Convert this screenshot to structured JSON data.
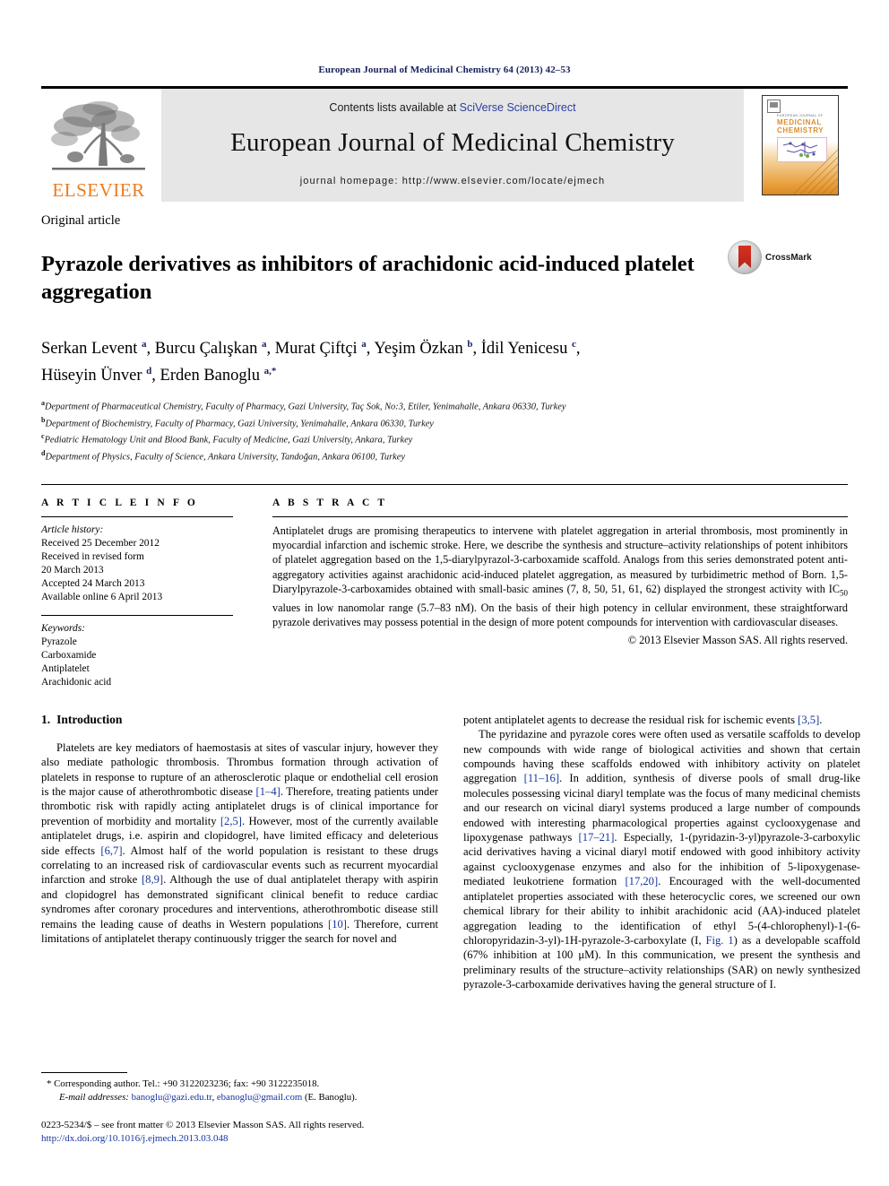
{
  "running_head": "European Journal of Medicinal Chemistry 64 (2013) 42–53",
  "masthead": {
    "publisher_name": "ELSEVIER",
    "contents_prefix": "Contents lists available at ",
    "contents_link": "SciVerse ScienceDirect",
    "journal_title": "European Journal of Medicinal Chemistry",
    "homepage": "journal homepage: http://www.elsevier.com/locate/ejmech",
    "cover": {
      "publisher_line": "EUROPEAN JOURNAL OF",
      "title_line1": "MEDICINAL",
      "title_line2": "CHEMISTRY"
    }
  },
  "article": {
    "type": "Original article",
    "title": "Pyrazole derivatives as inhibitors of arachidonic acid-induced platelet aggregation",
    "crossmark_label": "CrossMark",
    "authors_line1": "Serkan Levent a, Burcu Çalışkan a, Murat Çiftçi a, Yeşim Özkan b, İdil Yenicesu c,",
    "authors_line2": "Hüseyin Ünver d, Erden Banoglu a,*",
    "affiliations": [
      {
        "mark": "a",
        "text": "Department of Pharmaceutical Chemistry, Faculty of Pharmacy, Gazi University, Taç Sok, No:3, Etiler, Yenimahalle, Ankara 06330, Turkey"
      },
      {
        "mark": "b",
        "text": "Department of Biochemistry, Faculty of Pharmacy, Gazi University, Yenimahalle, Ankara 06330, Turkey"
      },
      {
        "mark": "c",
        "text": "Pediatric Hematology Unit and Blood Bank, Faculty of Medicine, Gazi University, Ankara, Turkey"
      },
      {
        "mark": "d",
        "text": "Department of Physics, Faculty of Science, Ankara University, Tandoğan, Ankara 06100, Turkey"
      }
    ]
  },
  "article_info": {
    "heading": "A R T I C L E   I N F O",
    "history_label": "Article history:",
    "history": [
      "Received 25 December 2012",
      "Received in revised form",
      "20 March 2013",
      "Accepted 24 March 2013",
      "Available online 6 April 2013"
    ],
    "keywords_label": "Keywords:",
    "keywords": [
      "Pyrazole",
      "Carboxamide",
      "Antiplatelet",
      "Arachidonic acid"
    ]
  },
  "abstract": {
    "heading": "A B S T R A C T",
    "text_part1": "Antiplatelet drugs are promising therapeutics to intervene with platelet aggregation in arterial thrombosis, most prominently in myocardial infarction and ischemic stroke. Here, we describe the synthesis and structure–activity relationships of potent inhibitors of platelet aggregation based on the 1,5-diarylpyrazol-3-carboxamide scaffold. Analogs from this series demonstrated potent anti-aggregatory activities against arachidonic acid-induced platelet aggregation, as measured by turbidimetric method of Born. 1,5-Diarylpyrazole-3-carboxamides obtained with small-basic amines (7, 8, 50, 51, 61, 62) displayed the strongest activity with IC",
    "sub": "50",
    "text_part2": " values in low nanomolar range (5.7–83 nM). On the basis of their high potency in cellular environment, these straightforward pyrazole derivatives may possess potential in the design of more potent compounds for intervention with cardiovascular diseases.",
    "copyright": "© 2013 Elsevier Masson SAS. All rights reserved."
  },
  "introduction": {
    "number": "1.",
    "heading": "Introduction",
    "left_p1_a": "Platelets are key mediators of haemostasis at sites of vascular injury, however they also mediate pathologic thrombosis. Thrombus formation through activation of platelets in response to rupture of an atherosclerotic plaque or endothelial cell erosion is the major cause of atherothrombotic disease ",
    "ref_1_4": "[1–4]",
    "left_p1_b": ". Therefore, treating patients under thrombotic risk with rapidly acting antiplatelet drugs is of clinical importance for prevention of morbidity and mortality ",
    "ref_2_5": "[2,5]",
    "left_p1_c": ". However, most of the currently available antiplatelet drugs, i.e. aspirin and clopidogrel, have limited efficacy and deleterious side effects ",
    "ref_6_7": "[6,7]",
    "left_p1_d": ". Almost half of the world population is resistant to these drugs correlating to an increased risk of cardiovascular events such as recurrent myocardial infarction and stroke ",
    "ref_8_9": "[8,9]",
    "left_p1_e": ". Although the use of dual antiplatelet therapy with aspirin and clopidogrel has demonstrated significant clinical benefit to reduce cardiac syndromes after coronary procedures and interventions, atherothrombotic disease still remains the leading cause of deaths in Western populations ",
    "ref_10": "[10]",
    "left_p1_f": ". Therefore, current limitations of antiplatelet therapy continuously trigger the search for novel and ",
    "right_p1_a": "potent antiplatelet agents to decrease the residual risk for ischemic events ",
    "ref_3_5": "[3,5]",
    "right_p1_b": ".",
    "right_p2_a": "The pyridazine and pyrazole cores were often used as versatile scaffolds to develop new compounds with wide range of biological activities and shown that certain compounds having these scaffolds endowed with inhibitory activity on platelet aggregation ",
    "ref_11_16": "[11–16]",
    "right_p2_b": ". In addition, synthesis of diverse pools of small drug-like molecules possessing vicinal diaryl template was the focus of many medicinal chemists and our research on vicinal diaryl systems produced a large number of compounds endowed with interesting pharmacological properties against cyclooxygenase and lipoxygenase pathways ",
    "ref_17_21": "[17–21]",
    "right_p2_c": ". Especially, 1-(pyridazin-3-yl)pyrazole-3-carboxylic acid derivatives having a vicinal diaryl motif endowed with good inhibitory activity against cyclooxygenase enzymes and also for the inhibition of 5-lipoxygenase-mediated leukotriene formation ",
    "ref_17_20": "[17,20]",
    "right_p2_d": ". Encouraged with the well-documented antiplatelet properties associated with these heterocyclic cores, we screened our own chemical library for their ability to inhibit arachidonic acid (AA)-induced platelet aggregation leading to the identification of ethyl 5-(4-chlorophenyl)-1-(6-chloropyridazin-3-yl)-1H-pyrazole-3-carboxylate (I, ",
    "ref_fig1": "Fig. 1",
    "right_p2_e": ") as a developable scaffold (67% inhibition at 100 μM). In this communication, we present the synthesis and preliminary results of the structure–activity relationships (SAR) on newly synthesized pyrazole-3-carboxamide derivatives having the general structure of I."
  },
  "footnote": {
    "corresponding": "* Corresponding author. Tel.: +90 3122023236; fax: +90 3122235018.",
    "email_label": "E-mail addresses:",
    "email1": "banoglu@gazi.edu.tr",
    "email_sep": ", ",
    "email2": "ebanoglu@gmail.com",
    "email_suffix": " (E. Banoglu).",
    "issn_line": "0223-5234/$ – see front matter © 2013 Elsevier Masson SAS. All rights reserved.",
    "doi": "http://dx.doi.org/10.1016/j.ejmech.2013.03.048"
  }
}
